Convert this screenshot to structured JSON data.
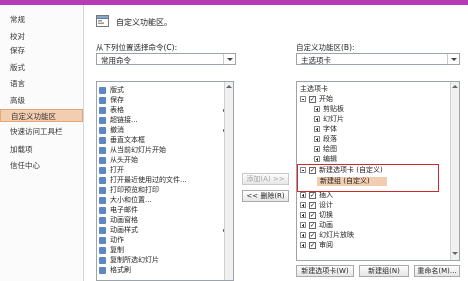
{
  "sidebar": {
    "items": [
      {
        "label": "常规"
      },
      {
        "label": "校对"
      },
      {
        "label": "保存"
      },
      {
        "label": "版式"
      },
      {
        "label": "语言"
      },
      {
        "label": "高级"
      },
      {
        "label": "自定义功能区"
      },
      {
        "label": "快速访问工具栏"
      },
      {
        "label": "加载项"
      },
      {
        "label": "信任中心"
      }
    ]
  },
  "header": {
    "title": "自定义功能区。"
  },
  "left": {
    "label": "从下列位置选择命令(C):",
    "select_value": "常用命令",
    "items": [
      {
        "label": "版式",
        "arrow": false
      },
      {
        "label": "保存",
        "arrow": false
      },
      {
        "label": "表格",
        "arrow": true
      },
      {
        "label": "超链接...",
        "arrow": false
      },
      {
        "label": "撤消",
        "arrow": true
      },
      {
        "label": "垂直文本框",
        "arrow": false
      },
      {
        "label": "从当前幻灯片开始",
        "arrow": false
      },
      {
        "label": "从头开始",
        "arrow": false
      },
      {
        "label": "打开",
        "arrow": false
      },
      {
        "label": "打开最近使用过的文件...",
        "arrow": false
      },
      {
        "label": "打印预览和打印",
        "arrow": false
      },
      {
        "label": "大小和位置...",
        "arrow": false
      },
      {
        "label": "电子邮件",
        "arrow": false
      },
      {
        "label": "动画窗格",
        "arrow": false
      },
      {
        "label": "动画样式",
        "arrow": true
      },
      {
        "label": "动作",
        "arrow": false
      },
      {
        "label": "复制",
        "arrow": false
      },
      {
        "label": "复制所选幻灯片",
        "arrow": false
      },
      {
        "label": "格式刷",
        "arrow": false
      }
    ]
  },
  "middle": {
    "add_label": "添加(A) >>",
    "remove_label": "<< 删除(R)"
  },
  "right": {
    "label": "自定义功能区(B):",
    "select_value": "主选项卡",
    "header": "主选项卡",
    "tree": [
      {
        "label": "开始",
        "level": 1,
        "expander": "minus",
        "checked": true
      },
      {
        "label": "剪贴板",
        "level": 2,
        "expander": "plus",
        "checked": null
      },
      {
        "label": "幻灯片",
        "level": 2,
        "expander": "plus",
        "checked": null
      },
      {
        "label": "字体",
        "level": 2,
        "expander": "plus",
        "checked": null
      },
      {
        "label": "段落",
        "level": 2,
        "expander": "plus",
        "checked": null
      },
      {
        "label": "绘图",
        "level": 2,
        "expander": "plus",
        "checked": null
      },
      {
        "label": "编辑",
        "level": 2,
        "expander": "plus",
        "checked": null
      },
      {
        "label": "新建选项卡 (自定义)",
        "level": 1,
        "expander": "minus",
        "checked": true
      },
      {
        "label": "新建组 (自定义)",
        "level": 2,
        "expander": null,
        "checked": null,
        "selected": true
      },
      {
        "label": "插入",
        "level": 1,
        "expander": "plus",
        "checked": true
      },
      {
        "label": "设计",
        "level": 1,
        "expander": "plus",
        "checked": true
      },
      {
        "label": "切换",
        "level": 1,
        "expander": "plus",
        "checked": true
      },
      {
        "label": "动画",
        "level": 1,
        "expander": "plus",
        "checked": true
      },
      {
        "label": "幻灯片放映",
        "level": 1,
        "expander": "plus",
        "checked": true
      },
      {
        "label": "审阅",
        "level": 1,
        "expander": "plus",
        "checked": true
      }
    ],
    "buttons": {
      "new_tab": "新建选项卡(W)",
      "new_group": "新建组(N)",
      "rename": "重命名(M)..."
    }
  },
  "colors": {
    "accent_bar": "#b63cb7",
    "selection_bg": "#f3cdb0",
    "highlight_border": "#d0292c"
  }
}
